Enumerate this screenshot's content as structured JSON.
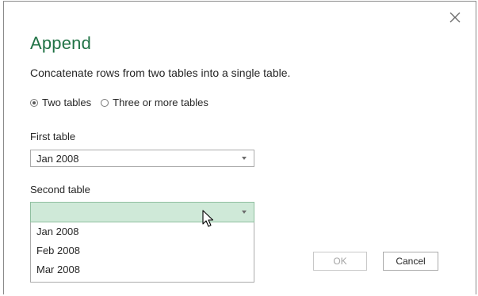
{
  "dialog": {
    "title": "Append",
    "description": "Concatenate rows from two tables into a single table.",
    "close_icon": "close-icon"
  },
  "mode": {
    "options": [
      {
        "label": "Two tables",
        "checked": true
      },
      {
        "label": "Three or more tables",
        "checked": false
      }
    ]
  },
  "first_table": {
    "label": "First table",
    "value": "Jan 2008"
  },
  "second_table": {
    "label": "Second table",
    "value": "",
    "options": [
      "Jan 2008",
      "Feb 2008",
      "Mar 2008"
    ]
  },
  "buttons": {
    "ok_label": "OK",
    "ok_enabled": false,
    "cancel_label": "Cancel"
  },
  "colors": {
    "title": "#217346",
    "dropdown_highlight": "#cfe9d8"
  }
}
